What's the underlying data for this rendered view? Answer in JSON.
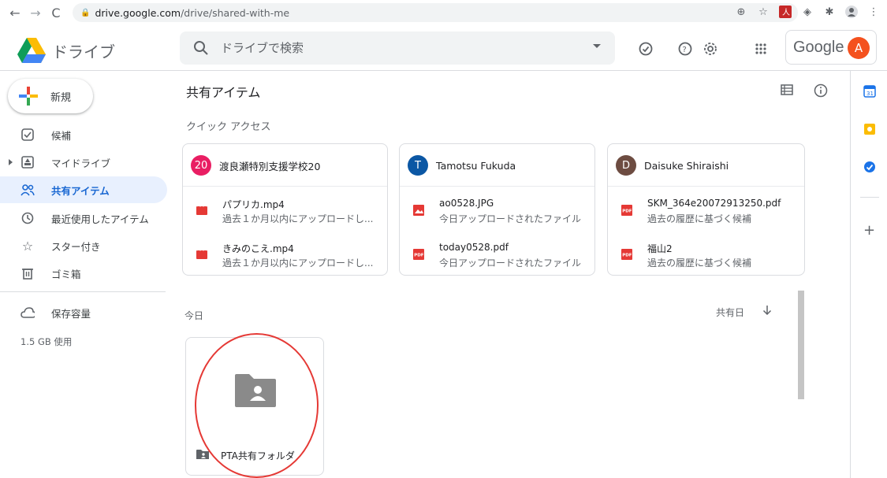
{
  "browser": {
    "url_host": "drive.google.com",
    "url_path": "/drive/shared-with-me"
  },
  "app": {
    "title": "ドライブ",
    "search_placeholder": "ドライブで検索",
    "google_word": "Google",
    "account_initial": "A"
  },
  "sidebar": {
    "new_label": "新規",
    "items": [
      {
        "label": "候補",
        "icon": "check-square-icon"
      },
      {
        "label": "マイドライブ",
        "icon": "drive-icon"
      },
      {
        "label": "共有アイテム",
        "icon": "people-icon"
      },
      {
        "label": "最近使用したアイテム",
        "icon": "clock-icon"
      },
      {
        "label": "スター付き",
        "icon": "star-icon"
      },
      {
        "label": "ゴミ箱",
        "icon": "trash-icon"
      },
      {
        "label": "保存容量",
        "icon": "cloud-icon"
      }
    ],
    "storage_used": "1.5 GB 使用"
  },
  "main": {
    "title": "共有アイテム",
    "quick_access_label": "クイック アクセス",
    "cards": [
      {
        "avatar": "20",
        "avatar_color": "#e91e63",
        "owner": "渡良瀬特別支援学校20",
        "files": [
          {
            "name": "パプリカ.mp4",
            "sub": "過去１か月以内にアップロードし...",
            "type": "video"
          },
          {
            "name": "きみのこえ.mp4",
            "sub": "過去１か月以内にアップロードし...",
            "type": "video"
          }
        ]
      },
      {
        "avatar": "T",
        "avatar_color": "#0b57a4",
        "owner": "Tamotsu Fukuda",
        "files": [
          {
            "name": "ao0528.JPG",
            "sub": "今日アップロードされたファイル",
            "type": "image"
          },
          {
            "name": "today0528.pdf",
            "sub": "今日アップロードされたファイル",
            "type": "pdf"
          }
        ]
      },
      {
        "avatar": "D",
        "avatar_color": "#6d4c41",
        "owner": "Daisuke Shiraishi",
        "files": [
          {
            "name": "SKM_364e20072913250.pdf",
            "sub": "過去の履歴に基づく候補",
            "type": "pdf"
          },
          {
            "name": "福山2",
            "sub": "過去の履歴に基づく候補",
            "type": "pdf"
          }
        ]
      }
    ],
    "today_label": "今日",
    "sort_label": "共有日",
    "folder_name": "PTA共有フォルダ"
  },
  "colors": {
    "active_bg": "#e8f0fe",
    "active_text": "#1967d2",
    "annotation_red": "#e53935"
  }
}
